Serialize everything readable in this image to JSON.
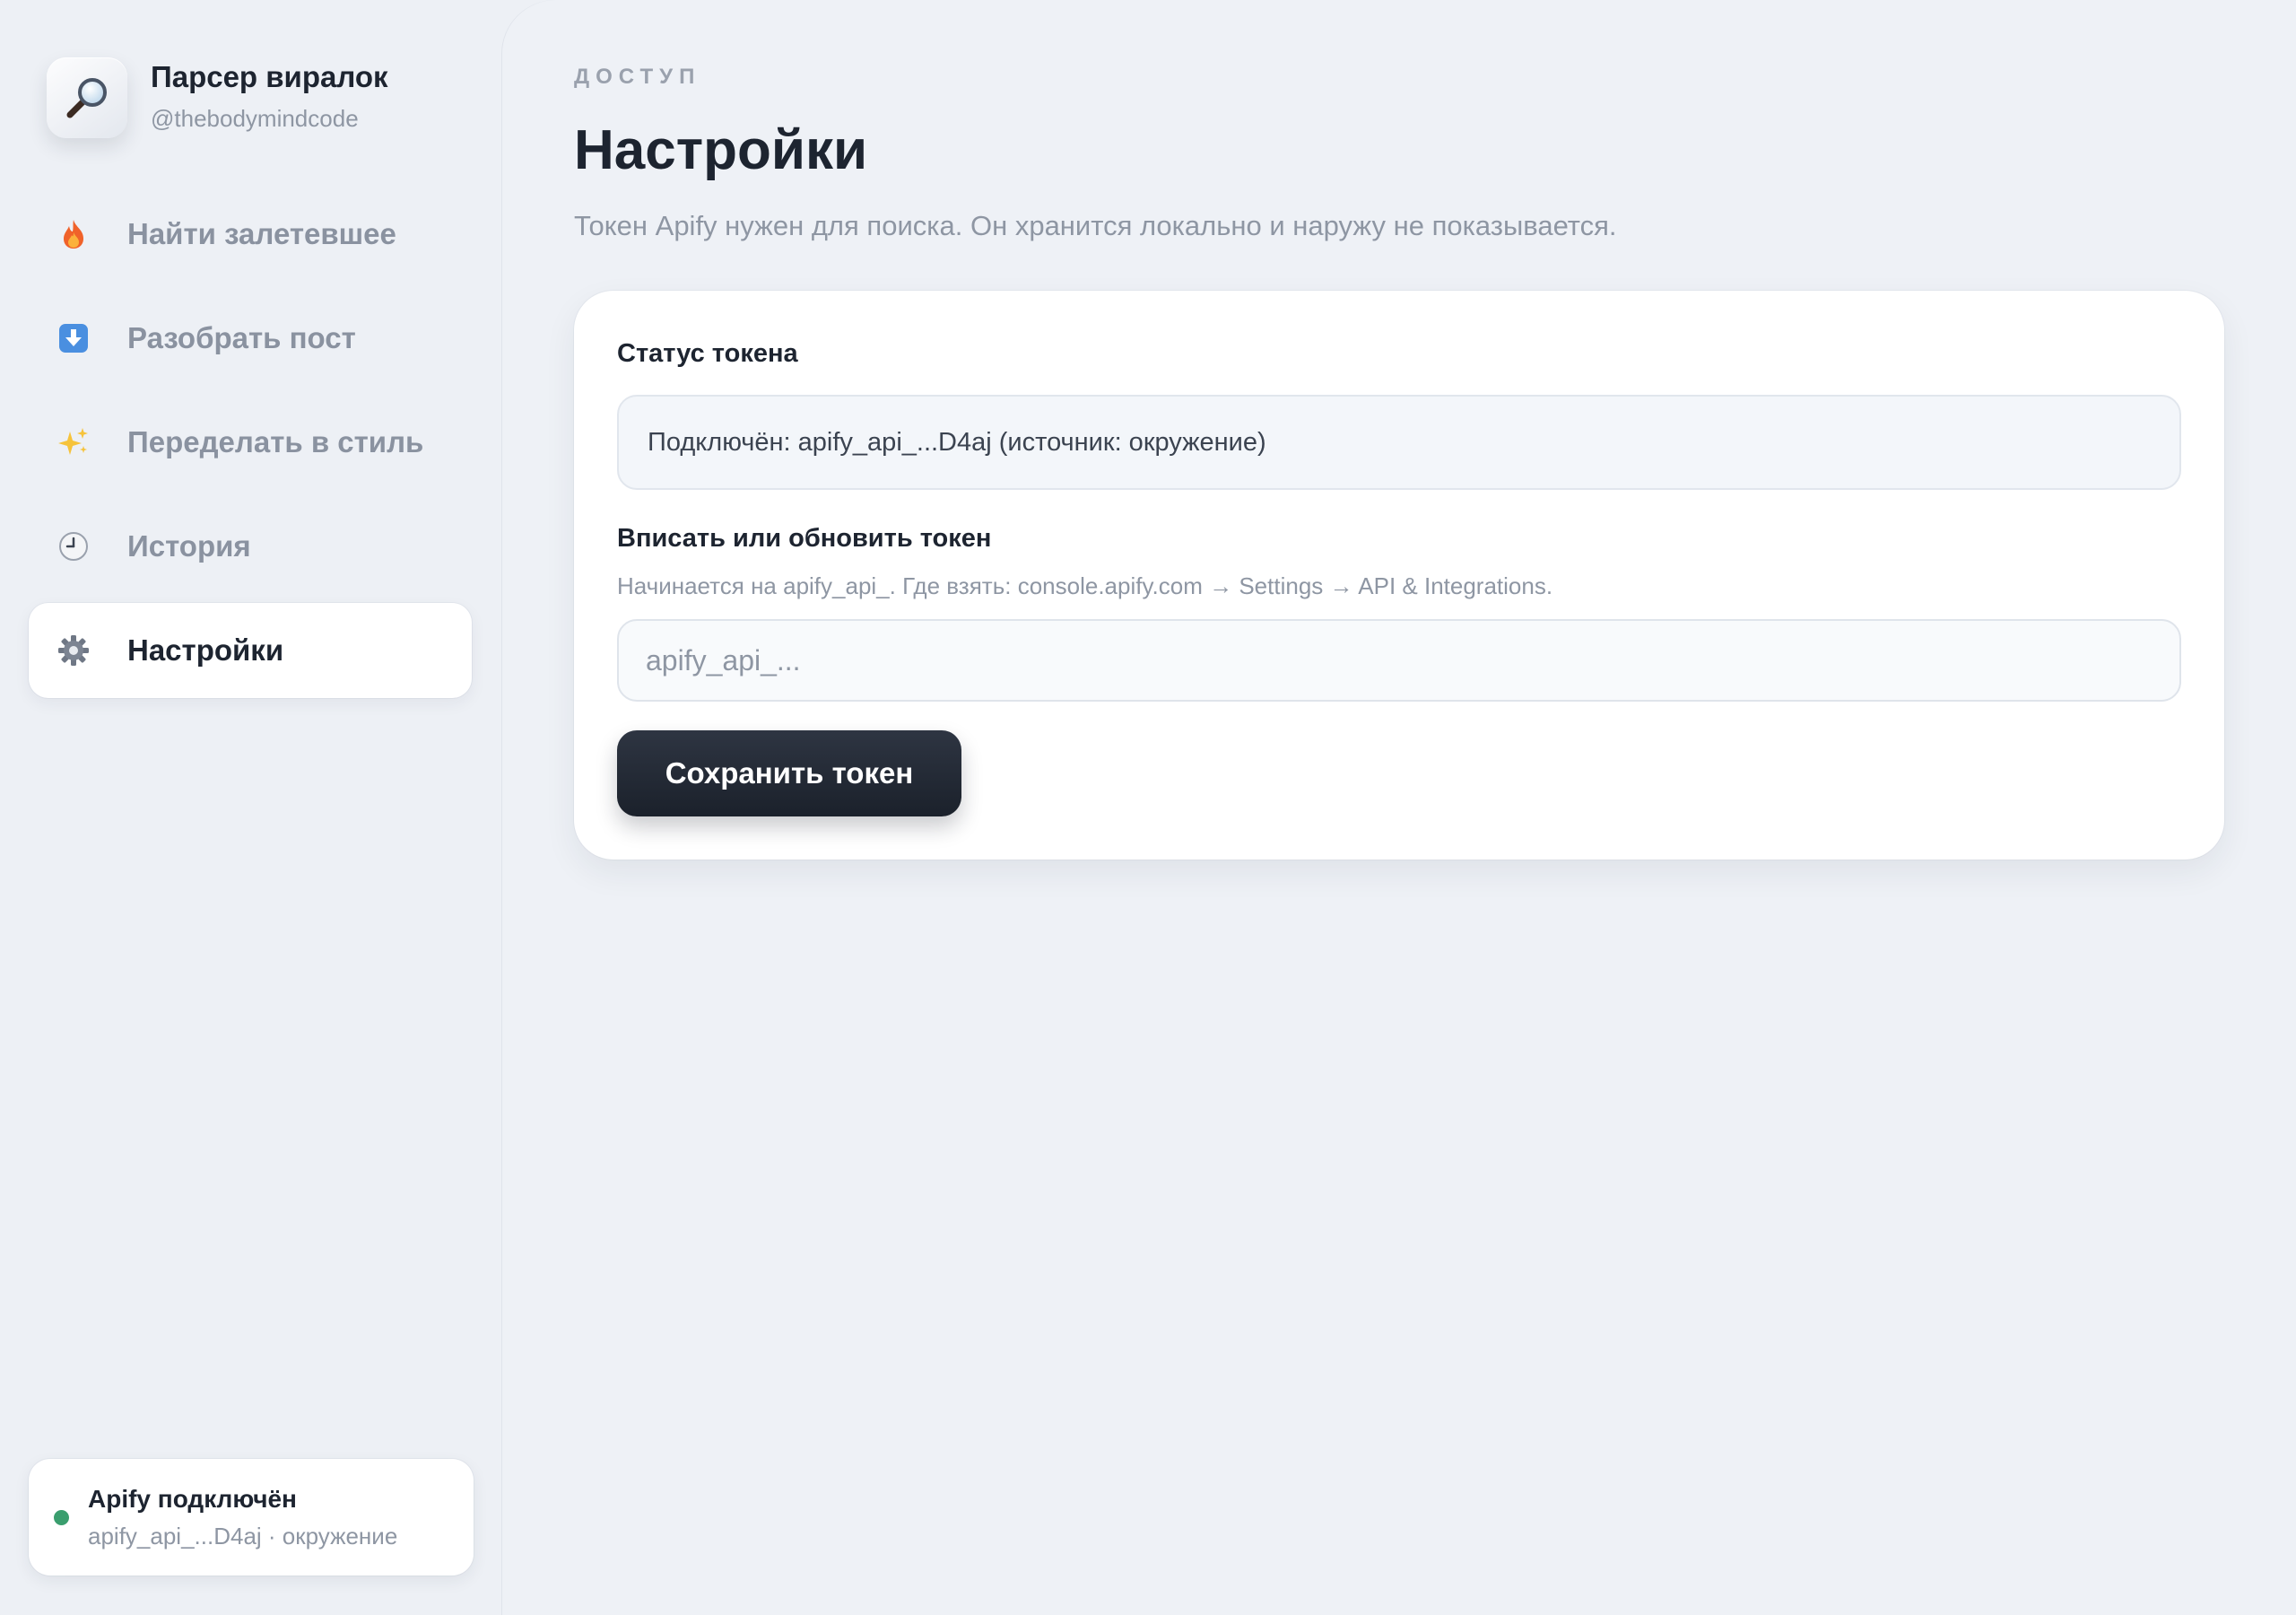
{
  "app": {
    "title": "Парсер виралок",
    "handle": "@thebodymindcode",
    "logo_icon": "magnifier-icon"
  },
  "sidebar": {
    "items": [
      {
        "label": "Найти залетевшее",
        "icon": "fire-icon",
        "active": false
      },
      {
        "label": "Разобрать пост",
        "icon": "download-icon",
        "active": false
      },
      {
        "label": "Переделать в стиль",
        "icon": "sparkles-icon",
        "active": false
      },
      {
        "label": "История",
        "icon": "clock-icon",
        "active": false
      },
      {
        "label": "Настройки",
        "icon": "gear-icon",
        "active": true
      }
    ],
    "status": {
      "title": "Apify подключён",
      "subtitle": "apify_api_...D4aj · окружение",
      "dot_color": "#3a9e6e"
    }
  },
  "main": {
    "eyebrow": "ДОСТУП",
    "title": "Настройки",
    "description": "Токен Apify нужен для поиска. Он хранится локально и наружу не показывается.",
    "card": {
      "status_label": "Статус токена",
      "status_value": "Подключён: apify_api_...D4aj (источник: окружение)",
      "token_label": "Вписать или обновить токен",
      "token_hint": "Начинается на apify_api_. Где взять: console.apify.com → Settings → API & Integrations.",
      "token_placeholder": "apify_api_...",
      "token_value": "",
      "save_label": "Сохранить токен"
    }
  },
  "colors": {
    "background": "#edf0f5",
    "text_primary": "#1d2430",
    "text_muted": "#8e96a3",
    "button_dark": "#1b212b",
    "status_green": "#3a9e6e"
  }
}
